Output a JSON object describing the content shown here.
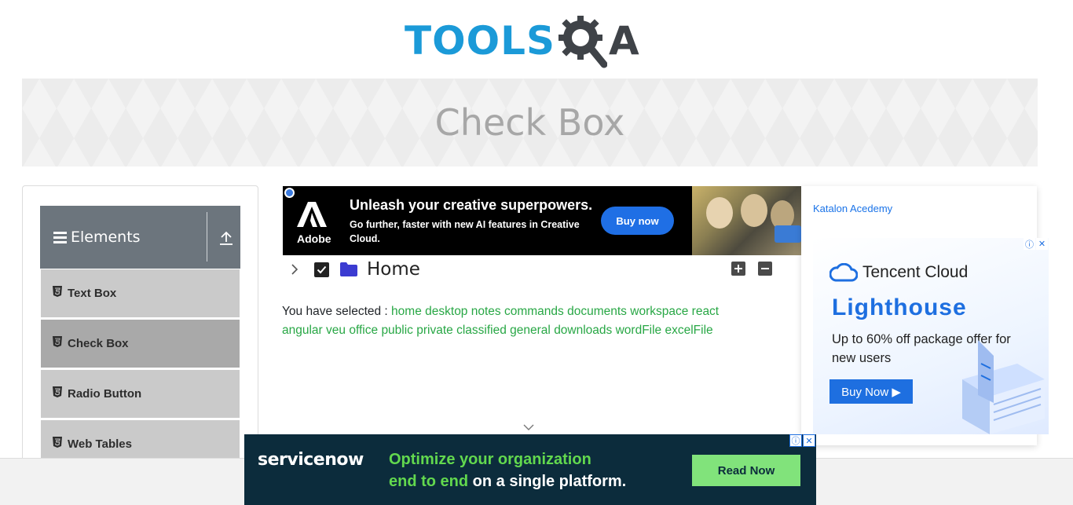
{
  "logo": {
    "text_left": "TOOLS",
    "text_right": "A",
    "brand_blue": "#1b9ad8",
    "brand_dark": "#3f4348"
  },
  "banner": {
    "title": "Check Box"
  },
  "sidebar": {
    "group_title": "Elements",
    "items": [
      {
        "label": "Text Box",
        "active": false
      },
      {
        "label": "Check Box",
        "active": true
      },
      {
        "label": "Radio Button",
        "active": false
      },
      {
        "label": "Web Tables",
        "active": false
      }
    ]
  },
  "ad_top": {
    "brand": "Adobe",
    "headline": "Unleash your creative superpowers.",
    "subtext": "Go further, faster with new AI features in Creative Cloud.",
    "button": "Buy now"
  },
  "tree": {
    "root_label": "Home",
    "checked": true,
    "expand_all_icon": "plus-square-icon",
    "collapse_all_icon": "minus-square-icon"
  },
  "result": {
    "prefix": "You have selected :",
    "items": [
      "home",
      "desktop",
      "notes",
      "commands",
      "documents",
      "workspace",
      "react",
      "angular",
      "veu",
      "office",
      "public",
      "private",
      "classified",
      "general",
      "downloads",
      "wordFile",
      "excelFile"
    ]
  },
  "ad_right": {
    "link": "Katalon Acedemy",
    "brand": "Tencent Cloud",
    "product": "Lighthouse",
    "offer": "Up to 60% off package offer for new users",
    "button": "Buy Now ▶"
  },
  "ad_bottom": {
    "brand": "servicenow",
    "line1": "Optimize your organization",
    "line2_highlight": "end to end",
    "line2_rest": " on a single platform.",
    "button": "Read Now"
  },
  "colors": {
    "green": "#28a745",
    "sidebar_header": "#6c757d",
    "sidebar_item": "#cacaca",
    "sidebar_active": "#a9a9a9"
  }
}
